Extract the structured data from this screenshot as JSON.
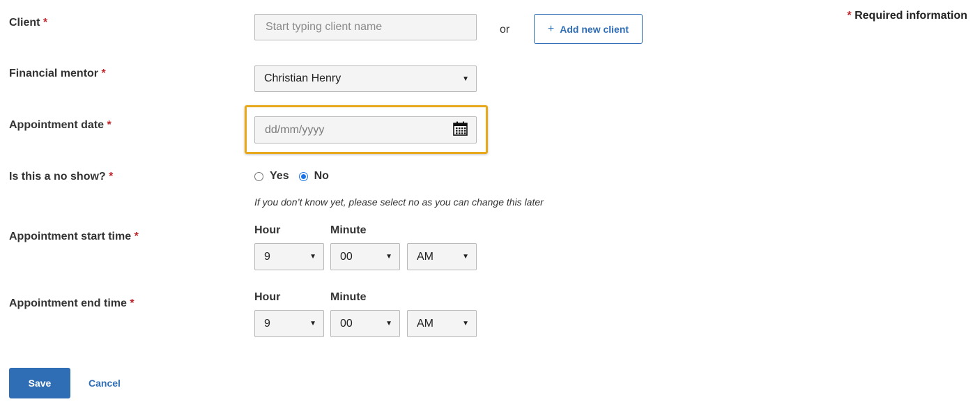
{
  "required_info": {
    "star": "*",
    "text": "Required information"
  },
  "client": {
    "label": "Client",
    "star": "*",
    "placeholder": "Start typing client name",
    "or_text": "or",
    "add_button": {
      "icon": "plus-icon",
      "plus": "+",
      "label": "Add new client"
    }
  },
  "mentor": {
    "label": "Financial mentor",
    "star": "*",
    "selected": "Christian Henry"
  },
  "date": {
    "label": "Appointment date",
    "star": "*",
    "placeholder": "dd/mm/yyyy",
    "icon": "calendar-icon"
  },
  "no_show": {
    "label": "Is this a no show?",
    "star": "*",
    "options": [
      {
        "label": "Yes",
        "checked": false
      },
      {
        "label": "No",
        "checked": true
      }
    ],
    "hint": "If you don’t know yet, please select no as you can change this later"
  },
  "start_time": {
    "label": "Appointment start time",
    "star": "*",
    "hour_label": "Hour",
    "minute_label": "Minute",
    "hour": "9",
    "minute": "00",
    "ampm": "AM"
  },
  "end_time": {
    "label": "Appointment end time",
    "star": "*",
    "hour_label": "Hour",
    "minute_label": "Minute",
    "hour": "9",
    "minute": "00",
    "ampm": "AM"
  },
  "actions": {
    "save": "Save",
    "cancel": "Cancel"
  },
  "colors": {
    "accent": "#2f6db5",
    "required": "#c0272d",
    "focus": "#e8a81c",
    "radio": "#1a73e8"
  }
}
